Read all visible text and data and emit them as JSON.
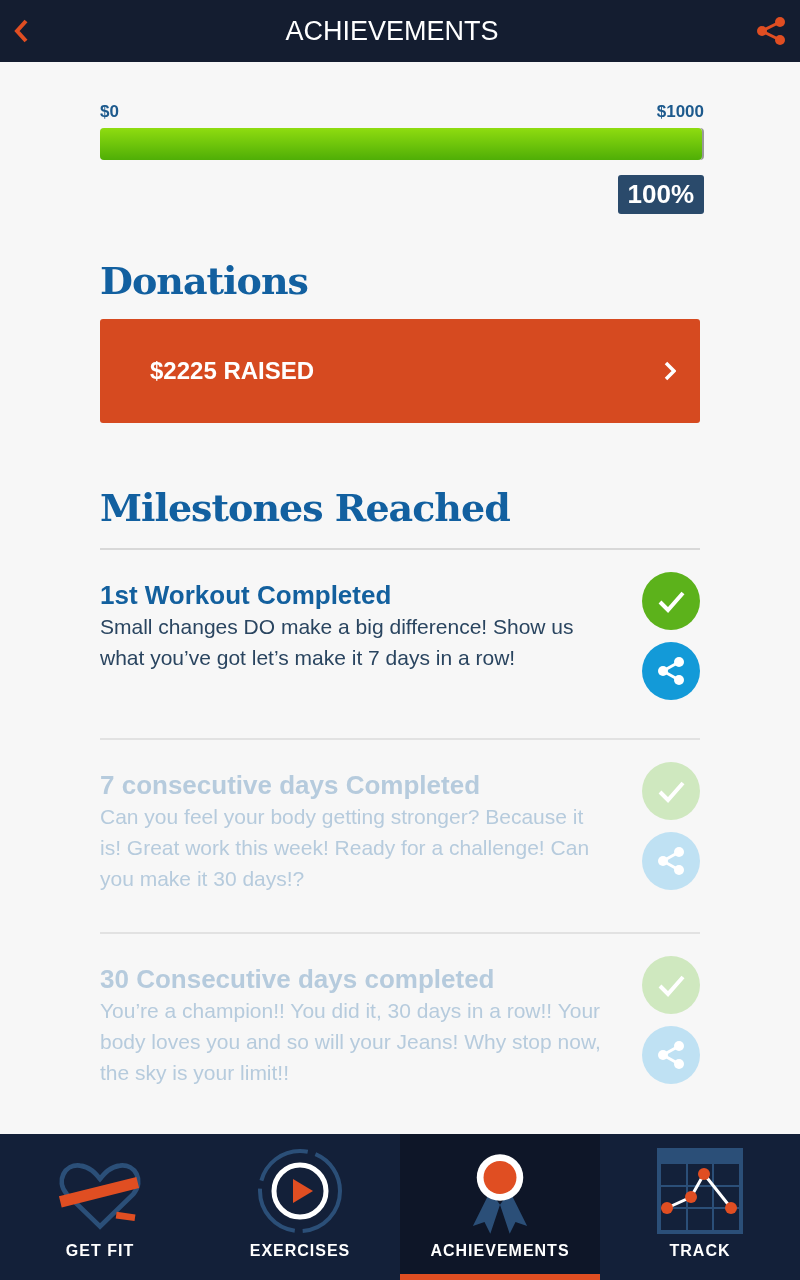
{
  "header": {
    "title": "ACHIEVEMENTS"
  },
  "progress": {
    "min_label": "$0",
    "max_label": "$1000",
    "level": 1.0,
    "percent": "100%"
  },
  "donations": {
    "heading": "Donations",
    "button": "$2225 RAISED"
  },
  "milestones": {
    "heading": "Milestones Reached",
    "items": [
      {
        "title": "1st Workout Completed",
        "text": "Small changes DO make a big difference! Show us what you’ve got let’s make it 7 days in a row!",
        "completed": true
      },
      {
        "title": "7 consecutive days Completed",
        "text": "Can you feel your body getting stronger? Because it is! Great work this week! Ready for a challenge! Can you make it 30 days!?",
        "completed": false
      },
      {
        "title": "30 Consecutive days completed",
        "text": "You’re a champion!! You did it, 30 days in a row!! Your body loves you and so will your Jeans! Why stop now, the sky is your limit!!",
        "completed": false
      }
    ]
  },
  "nav": [
    {
      "label": "GET FIT",
      "kind": "heart",
      "selected": false
    },
    {
      "label": "EXERCISES",
      "kind": "play",
      "selected": false
    },
    {
      "label": "ACHIEVEMENTS",
      "kind": "ribbon",
      "selected": true
    },
    {
      "label": "TRACK",
      "kind": "chart",
      "selected": false
    }
  ]
}
